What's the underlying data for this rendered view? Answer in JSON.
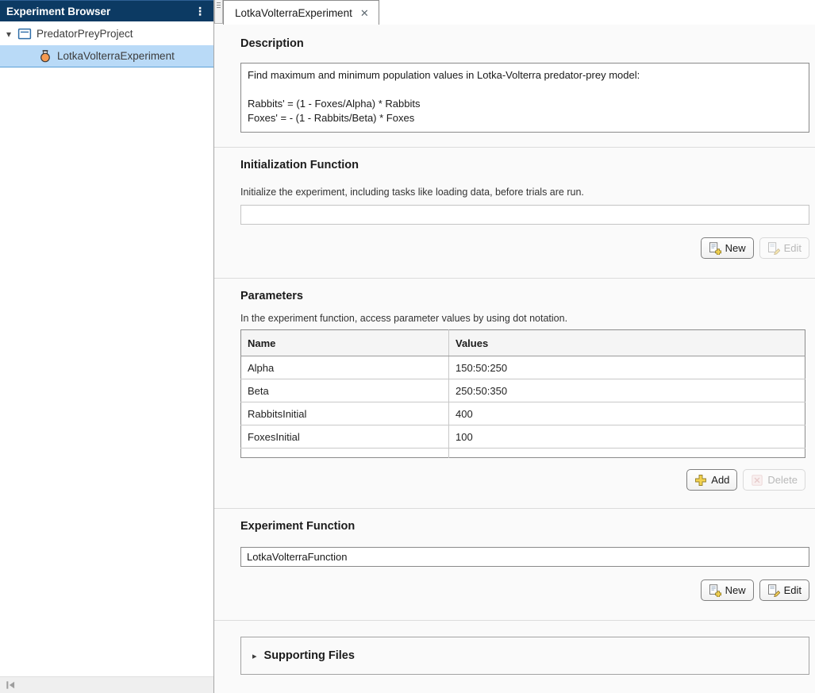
{
  "sidebar": {
    "title": "Experiment Browser",
    "tree": {
      "project_label": "PredatorPreyProject",
      "experiment_label": "LotkaVolterraExperiment"
    }
  },
  "tab": {
    "label": "LotkaVolterraExperiment"
  },
  "description": {
    "heading": "Description",
    "text": "Find maximum and minimum population values in Lotka-Volterra predator-prey model:\n\nRabbits' = (1 - Foxes/Alpha) * Rabbits\nFoxes' = - (1 - Rabbits/Beta) * Foxes"
  },
  "initialization": {
    "heading": "Initialization Function",
    "hint": "Initialize the experiment, including tasks like loading data, before trials are run.",
    "value": "",
    "new_label": "New",
    "edit_label": "Edit"
  },
  "parameters": {
    "heading": "Parameters",
    "hint": "In the experiment function, access parameter values by using dot notation.",
    "columns": {
      "name": "Name",
      "values": "Values"
    },
    "rows": [
      {
        "name": "Alpha",
        "values": "150:50:250"
      },
      {
        "name": "Beta",
        "values": "250:50:350"
      },
      {
        "name": "RabbitsInitial",
        "values": "400"
      },
      {
        "name": "FoxesInitial",
        "values": "100"
      }
    ],
    "add_label": "Add",
    "delete_label": "Delete"
  },
  "experiment_function": {
    "heading": "Experiment Function",
    "value": "LotkaVolterraFunction",
    "new_label": "New",
    "edit_label": "Edit"
  },
  "supporting_files": {
    "heading": "Supporting Files"
  },
  "icons": {
    "menu_ellipsis": "⋮",
    "caret_down": "▾",
    "chevron_right": "▸",
    "tab_close": "✕"
  },
  "colors": {
    "header_bg": "#0c3a63",
    "selection_bg": "#b9daf7",
    "accent_yellow": "#f3d250"
  }
}
